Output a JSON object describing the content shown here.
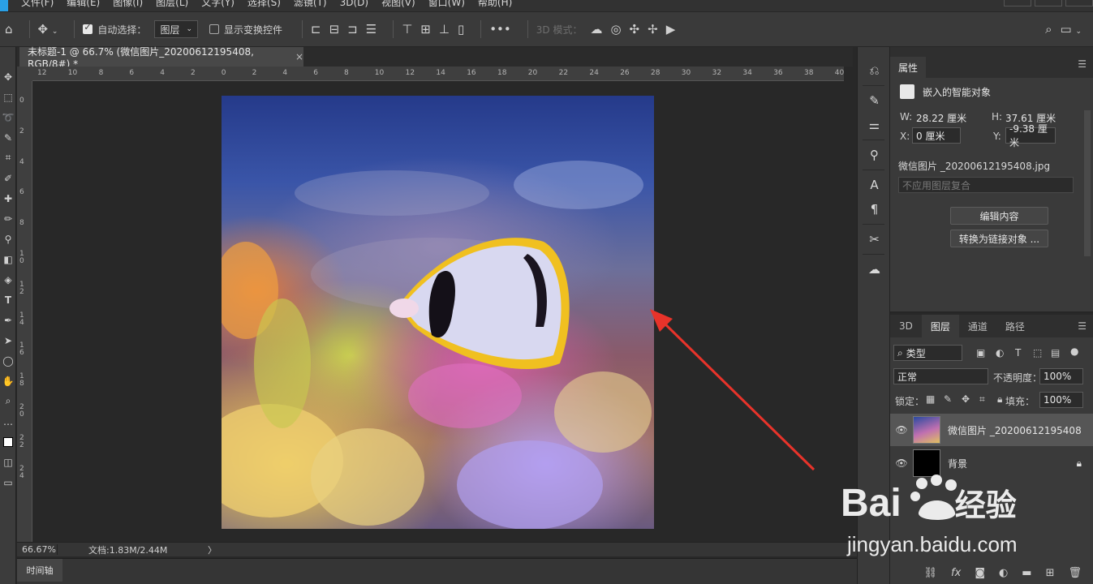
{
  "menubar": {
    "items": [
      "文件(F)",
      "编辑(E)",
      "图像(I)",
      "图层(L)",
      "文字(Y)",
      "选择(S)",
      "滤镜(T)",
      "3D(D)",
      "视图(V)",
      "窗口(W)",
      "帮助(H)"
    ]
  },
  "optionsbar": {
    "auto_select_label": "自动选择：",
    "auto_select_target": "图层",
    "show_transform_label": "显示变换控件",
    "more_label": "•••",
    "mode_3d_label": "3D 模式："
  },
  "document": {
    "tab_title": "未标题-1 @ 66.7% (微信图片_20200612195408, RGB/8#) *",
    "tab_close": "×",
    "zoom": "66.67%",
    "doc_size": "文档:1.83M/2.44M",
    "status_arrow": "〉"
  },
  "rulers": {
    "horizontal": [
      "12",
      "10",
      "8",
      "6",
      "4",
      "2",
      "0",
      "2",
      "4",
      "6",
      "8",
      "10",
      "12",
      "14",
      "16",
      "18",
      "20",
      "22",
      "24",
      "26",
      "28",
      "30",
      "32",
      "34",
      "36",
      "38",
      "40"
    ],
    "vertical": [
      "0",
      "2",
      "4",
      "6",
      "8",
      "1\n0",
      "1\n2",
      "1\n4",
      "1\n6",
      "1\n8",
      "2\n0",
      "2\n2",
      "2\n4"
    ]
  },
  "timeline": {
    "tab_label": "时间轴"
  },
  "properties": {
    "tab_label": "属性",
    "object_type": "嵌入的智能对象",
    "w_label": "W:",
    "w_value": "28.22 厘米",
    "h_label": "H:",
    "h_value": "37.61 厘米",
    "x_label": "X:",
    "x_value": "0 厘米",
    "y_label": "Y:",
    "y_value": "-9.38 厘米",
    "filename": "微信图片 _20200612195408.jpg",
    "layer_comp": "不应用图层复合",
    "edit_contents_label": "编辑内容",
    "convert_linked_label": "转换为链接对象 ..."
  },
  "layers_panel": {
    "tabs": [
      "3D",
      "图层",
      "通道",
      "路径"
    ],
    "active_tab": "图层",
    "filter_kind": "类型",
    "blend_mode": "正常",
    "opacity_label": "不透明度：",
    "opacity_value": "100%",
    "lock_label": "锁定：",
    "fill_label": "填充：",
    "fill_value": "100%",
    "layers": [
      {
        "name": "微信图片 _20200612195408",
        "selected": true
      },
      {
        "name": "背景",
        "selected": false
      }
    ]
  },
  "watermark": {
    "brand": "Bai",
    "brand2": "经验",
    "url": "jingyan.baidu.com"
  },
  "colors": {
    "panel_bg": "#3a3a3a",
    "canvas_bg": "#282828",
    "arrow": "#e8332a",
    "selected_layer": "#565656"
  },
  "icons": {
    "home": "home-icon",
    "move": "move-icon",
    "search": "search-icon",
    "eye": "eye-icon",
    "lock": "lock-icon"
  }
}
